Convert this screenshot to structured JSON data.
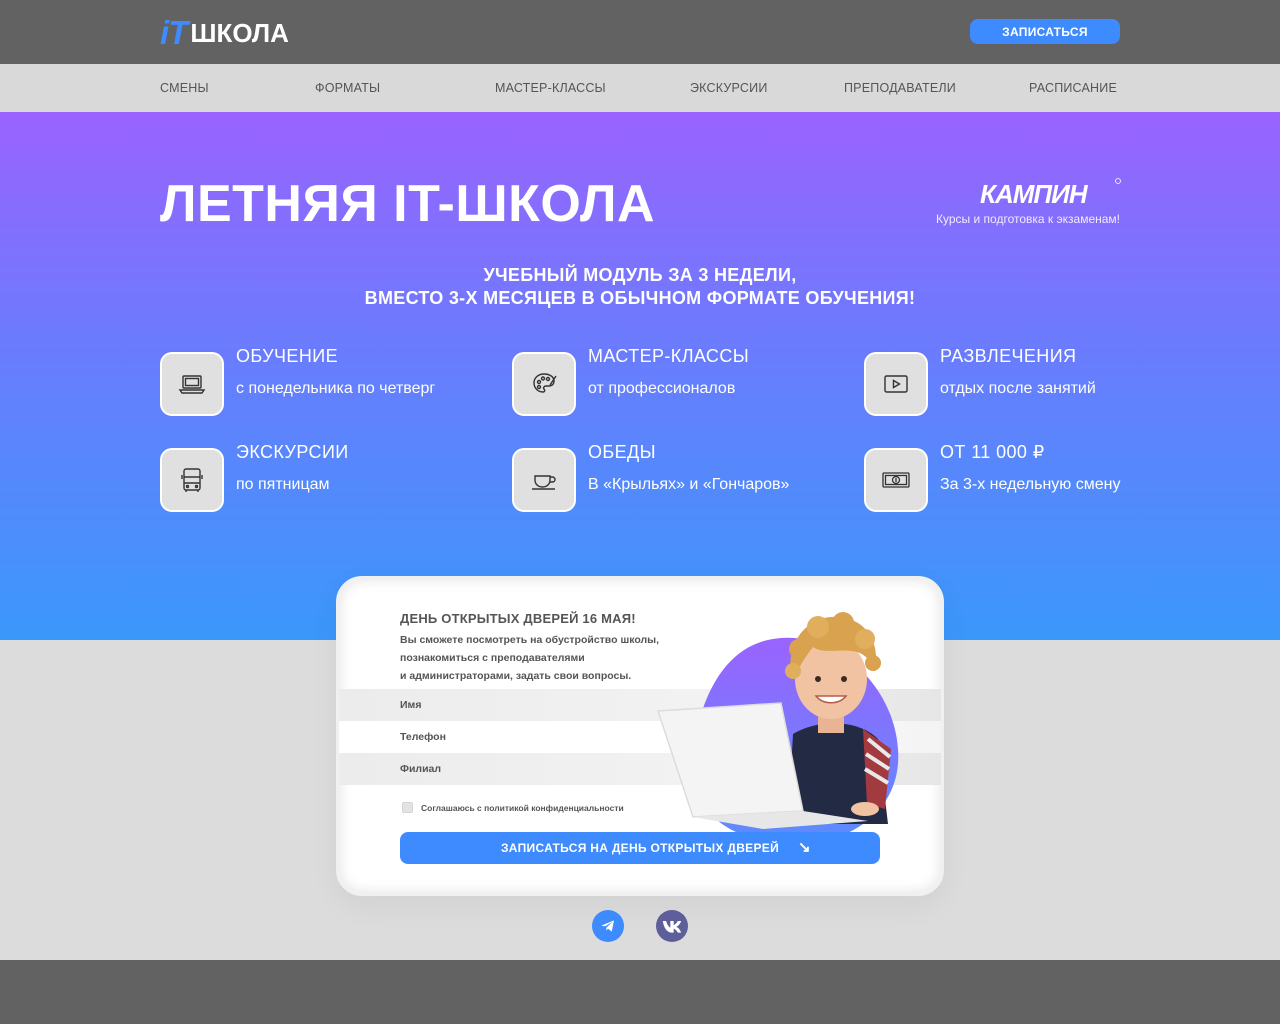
{
  "header": {
    "logo_it": "iT",
    "logo_school": "ШКОЛА",
    "signup_button": "ЗАПИСАТЬСЯ"
  },
  "nav": {
    "items": [
      "СМЕНЫ",
      "ФОРМАТЫ",
      "МАСТЕР-КЛАССЫ",
      "ЭКСКУРСИИ",
      "ПРЕПОДАВАТЕЛИ",
      "РАСПИСАНИЕ"
    ]
  },
  "hero": {
    "title": "ЛЕТНЯЯ IT-ШКОЛА",
    "partner_name": "КАМПИН",
    "partner_tagline": "Курсы и подготовка к экзаменам!",
    "subtitle_line1": "УЧЕБНЫЙ МОДУЛЬ ЗА 3 НЕДЕЛИ,",
    "subtitle_line2": "ВМЕСТО 3-Х МЕСЯЦЕВ В ОБЫЧНОМ ФОРМАТЕ ОБУЧЕНИЯ!"
  },
  "features": [
    {
      "title": "ОБУЧЕНИЕ",
      "desc": "с понедельника по четверг",
      "icon": "laptop-icon"
    },
    {
      "title": "МАСТЕР-КЛАССЫ",
      "desc": "от профессионалов",
      "icon": "palette-icon"
    },
    {
      "title": "РАЗВЛЕЧЕНИЯ",
      "desc": "отдых после занятий",
      "icon": "play-icon"
    },
    {
      "title": "ЭКСКУРСИИ",
      "desc": "по пятницам",
      "icon": "bus-icon"
    },
    {
      "title": "ОБЕДЫ",
      "desc": "В «Крыльях» и «Гончаров»",
      "icon": "cup-icon"
    },
    {
      "title": "ОТ 11 000 ₽",
      "desc": "За 3-х недельную смену",
      "icon": "money-icon"
    }
  ],
  "form": {
    "title": "ДЕНЬ ОТКРЫТЫХ ДВЕРЕЙ 16 МАЯ!",
    "text_line1": "Вы сможете посмотреть на обустройство школы,",
    "text_line2": "познакомиться с преподавателями",
    "text_line3": "и администраторами, задать свои вопросы.",
    "name_placeholder": "Имя",
    "phone_placeholder": "Телефон",
    "branch_placeholder": "Филиал",
    "consent_label": "Соглашаюсь с политикой конфиденциальности",
    "consent_checked": false,
    "submit_label": "ЗАПИСАТЬСЯ НА ДЕНЬ ОТКРЫТЫХ ДВЕРЕЙ",
    "submit_arrow": "↘"
  },
  "social": [
    {
      "icon": "telegram-icon"
    },
    {
      "icon": "vk-icon"
    }
  ],
  "colors": {
    "accent": "#3d8bff",
    "header_bg": "#626262",
    "gradient_top": "#9a63ff",
    "gradient_bottom": "#3a98fb"
  }
}
